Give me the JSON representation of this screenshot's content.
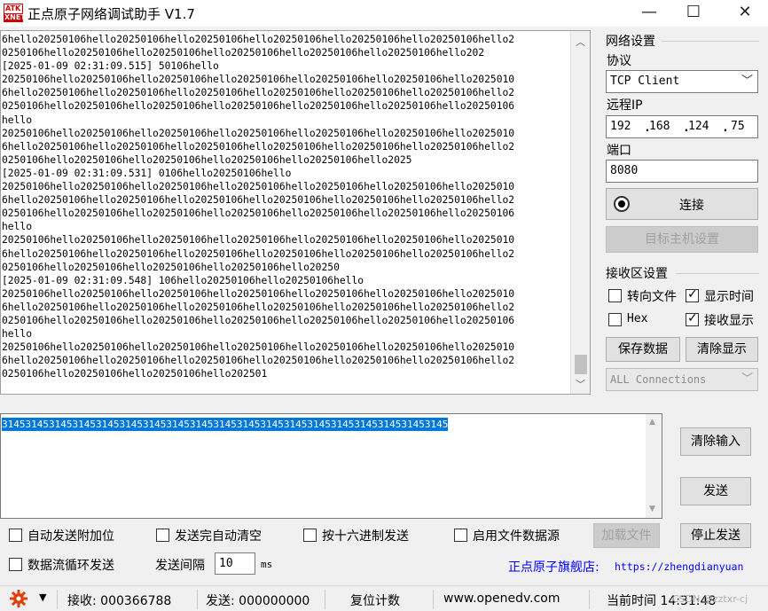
{
  "window": {
    "title": "正点原子网络调试助手 V1.7",
    "logo_line1": "ATK",
    "logo_line2": "XNET",
    "minimize_glyph": "—",
    "maximize_glyph": "☐",
    "close_glyph": "✕"
  },
  "receive": {
    "lines": [
      "6hello20250106hello20250106hello20250106hello20250106hello20250106hello20250106hello2",
      "0250106hello20250106hello20250106hello20250106hello20250106hello20250106hello202",
      "[2025-01-09 02:31:09.515] 50106hello",
      "20250106hello20250106hello20250106hello20250106hello20250106hello20250106hello2025010",
      "6hello20250106hello20250106hello20250106hello20250106hello20250106hello20250106hello2",
      "0250106hello20250106hello20250106hello20250106hello20250106hello20250106hello20250106",
      "hello",
      "20250106hello20250106hello20250106hello20250106hello20250106hello20250106hello2025010",
      "6hello20250106hello20250106hello20250106hello20250106hello20250106hello20250106hello2",
      "0250106hello20250106hello20250106hello20250106hello20250106hello2025",
      "[2025-01-09 02:31:09.531] 0106hello20250106hello",
      "20250106hello20250106hello20250106hello20250106hello20250106hello20250106hello2025010",
      "6hello20250106hello20250106hello20250106hello20250106hello20250106hello20250106hello2",
      "0250106hello20250106hello20250106hello20250106hello20250106hello20250106hello20250106",
      "hello",
      "20250106hello20250106hello20250106hello20250106hello20250106hello20250106hello2025010",
      "6hello20250106hello20250106hello20250106hello20250106hello20250106hello20250106hello2",
      "0250106hello20250106hello20250106hello20250106hello20250",
      "[2025-01-09 02:31:09.548] 106hello20250106hello20250106hello",
      "20250106hello20250106hello20250106hello20250106hello20250106hello20250106hello2025010",
      "6hello20250106hello20250106hello20250106hello20250106hello20250106hello20250106hello2",
      "0250106hello20250106hello20250106hello20250106hello20250106hello20250106hello20250106",
      "hello",
      "20250106hello20250106hello20250106hello20250106hello20250106hello20250106hello2025010",
      "6hello20250106hello20250106hello20250106hello20250106hello20250106hello20250106hello2",
      "0250106hello20250106hello20250106hello202501"
    ]
  },
  "network": {
    "group_title": "网络设置",
    "protocol_label": "协议",
    "protocol_value": "TCP Client",
    "remote_ip_label": "远程IP",
    "ip": [
      "192",
      "168",
      "124",
      "75"
    ],
    "port_label": "端口",
    "port_value": "8080",
    "connect_label": "连接",
    "target_host_label": "目标主机设置"
  },
  "receive_settings": {
    "group_title": "接收区设置",
    "redirect_file_label": "转向文件",
    "show_time_label": "显示时间",
    "hex_label": "Hex",
    "show_receive_label": "接收显示",
    "save_data_label": "保存数据",
    "clear_display_label": "清除显示",
    "connections_value": "ALL Connections"
  },
  "send": {
    "text": "3145314531453145314531453145314531453145314531453145314531453145314531453145",
    "clear_input_label": "清除输入",
    "send_label": "发送",
    "auto_append_label": "自动发送附加位",
    "auto_clear_label": "发送完自动清空",
    "hex_send_label": "按十六进制发送",
    "file_source_label": "启用文件数据源",
    "load_file_label": "加载文件",
    "stop_send_label": "停止发送",
    "loop_send_label": "数据流循环发送",
    "interval_label": "发送间隔",
    "interval_value": "10",
    "interval_unit": "ms",
    "promo_label": "正点原子旗舰店:",
    "promo_url": "https://zhengdianyuan"
  },
  "statusbar": {
    "receive_label": "接收: 000366788",
    "send_label": "发送: 000000000",
    "reset_label": "复位计数",
    "website": "www.openedv.com",
    "time_label": "当前时间 14:31:48",
    "watermark": "CSDN @zztxr-cj"
  },
  "colors": {
    "selection": "#0078d7",
    "promo_blue": "#0000ff",
    "settings_gear": "#e04010",
    "disabled_text": "#a0a0a0"
  },
  "icons": {
    "settings": "gear-icon",
    "dropdown": "chevron-down-icon",
    "connect_indicator": "radio-dot-icon"
  }
}
